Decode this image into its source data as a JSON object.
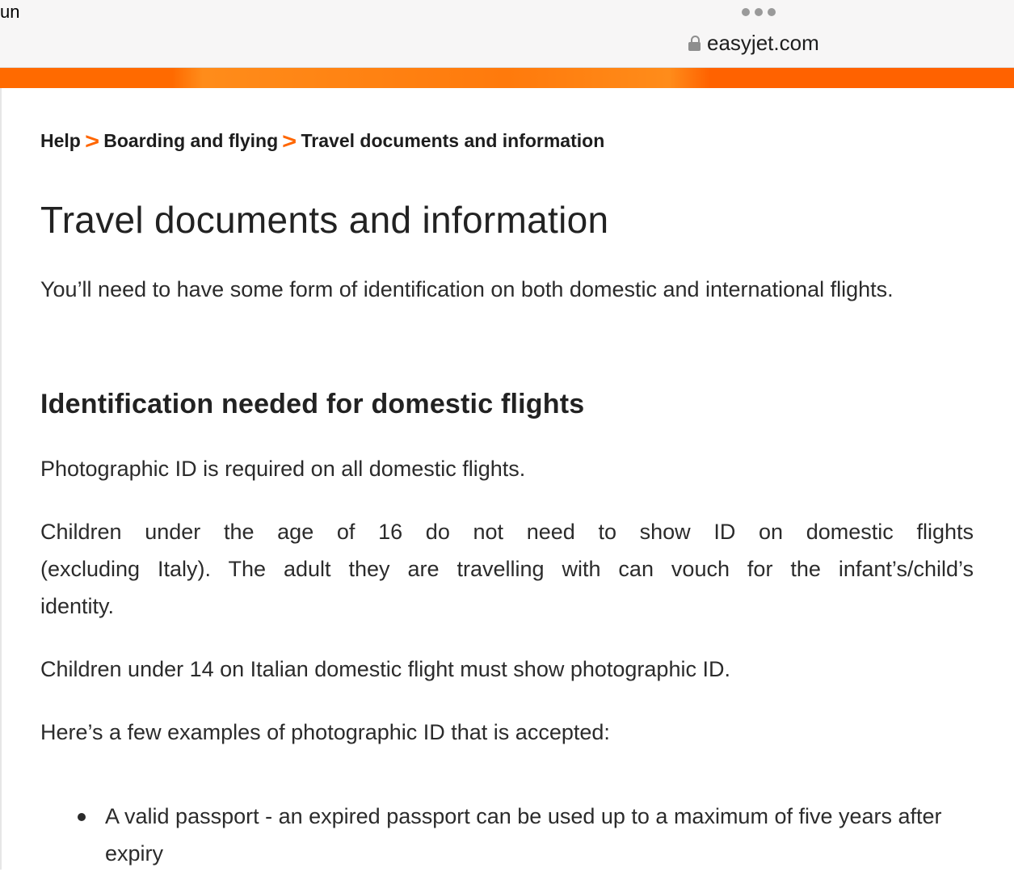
{
  "browser": {
    "tab_fragment": "un",
    "url": "easyjet.com"
  },
  "breadcrumb": {
    "items": [
      "Help",
      "Boarding and flying",
      "Travel documents and information"
    ],
    "separator": ">"
  },
  "page": {
    "title": "Travel documents and information",
    "intro": "You’ll need to have some form of identification on both domestic and international flights.",
    "section_heading": "Identification needed for domestic flights",
    "paragraphs": [
      "Photographic ID is required on all domestic flights.",
      "Children under the age of 16 do not need to show ID on domestic flights (excluding Italy). The adult they are travelling with can vouch for the infant’s/child’s identity.",
      "Children under 14 on Italian domestic flight must show photographic ID.",
      "Here’s a few examples of photographic ID that is accepted:"
    ],
    "bullets": [
      "A valid passport - an expired passport can be used up to a maximum of five years after expiry"
    ]
  },
  "colors": {
    "brand_orange": "#ff6600",
    "text": "#2b2b2b"
  }
}
